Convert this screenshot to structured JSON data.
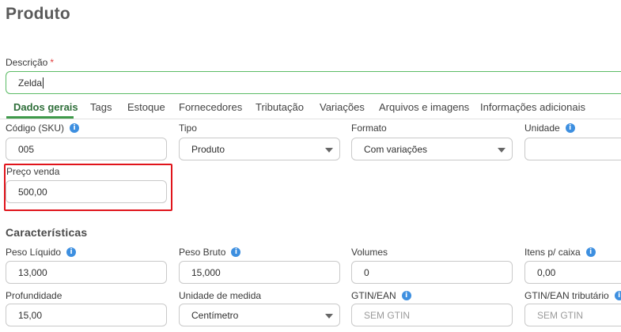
{
  "page": {
    "title": "Produto"
  },
  "descricao": {
    "label": "Descrição",
    "required_mark": "*",
    "value": "Zelda"
  },
  "tabs": [
    {
      "label": "Dados gerais"
    },
    {
      "label": "Tags"
    },
    {
      "label": "Estoque"
    },
    {
      "label": "Fornecedores"
    },
    {
      "label": "Tributação"
    },
    {
      "label": "Variações"
    },
    {
      "label": "Arquivos e imagens"
    },
    {
      "label": "Informações adicionais"
    }
  ],
  "fields": {
    "codigo": {
      "label": "Código (SKU)",
      "value": "005"
    },
    "tipo": {
      "label": "Tipo",
      "value": "Produto"
    },
    "formato": {
      "label": "Formato",
      "value": "Com variações"
    },
    "unidade": {
      "label": "Unidade",
      "value": ""
    },
    "preco_venda": {
      "label": "Preço venda",
      "value": "500,00"
    }
  },
  "caracteristicas": {
    "title": "Características",
    "peso_liquido": {
      "label": "Peso Líquido",
      "value": "13,000"
    },
    "peso_bruto": {
      "label": "Peso Bruto",
      "value": "15,000"
    },
    "volumes": {
      "label": "Volumes",
      "value": "0"
    },
    "itens_caixa": {
      "label": "Itens p/ caixa",
      "value": "0,00"
    },
    "profundidade": {
      "label": "Profundidade",
      "value": "15,00"
    },
    "unidade_medida": {
      "label": "Unidade de medida",
      "value": "Centímetro"
    },
    "gtin": {
      "label": "GTIN/EAN",
      "placeholder": "SEM GTIN"
    },
    "gtin_tributario": {
      "label": "GTIN/EAN tributário",
      "placeholder": "SEM GTIN"
    }
  },
  "icons": {
    "info": "i"
  },
  "colors": {
    "accent_green": "#3f9a4a",
    "info_blue": "#3d8fe0",
    "highlight_red": "#e0141b",
    "required_red": "#e23b3b"
  }
}
